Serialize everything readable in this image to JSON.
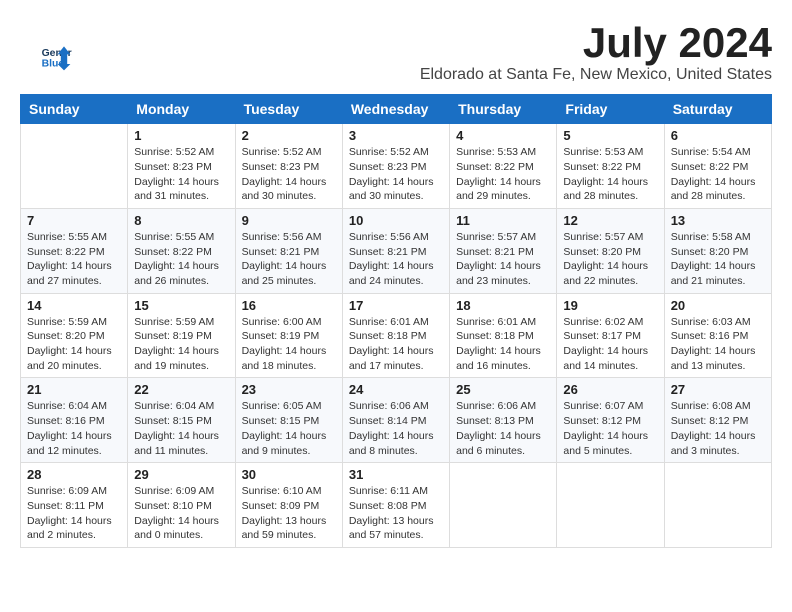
{
  "logo": {
    "line1": "General",
    "line2": "Blue"
  },
  "title": "July 2024",
  "location": "Eldorado at Santa Fe, New Mexico, United States",
  "days_of_week": [
    "Sunday",
    "Monday",
    "Tuesday",
    "Wednesday",
    "Thursday",
    "Friday",
    "Saturday"
  ],
  "weeks": [
    [
      {
        "day": "",
        "info": ""
      },
      {
        "day": "1",
        "info": "Sunrise: 5:52 AM\nSunset: 8:23 PM\nDaylight: 14 hours\nand 31 minutes."
      },
      {
        "day": "2",
        "info": "Sunrise: 5:52 AM\nSunset: 8:23 PM\nDaylight: 14 hours\nand 30 minutes."
      },
      {
        "day": "3",
        "info": "Sunrise: 5:52 AM\nSunset: 8:23 PM\nDaylight: 14 hours\nand 30 minutes."
      },
      {
        "day": "4",
        "info": "Sunrise: 5:53 AM\nSunset: 8:22 PM\nDaylight: 14 hours\nand 29 minutes."
      },
      {
        "day": "5",
        "info": "Sunrise: 5:53 AM\nSunset: 8:22 PM\nDaylight: 14 hours\nand 28 minutes."
      },
      {
        "day": "6",
        "info": "Sunrise: 5:54 AM\nSunset: 8:22 PM\nDaylight: 14 hours\nand 28 minutes."
      }
    ],
    [
      {
        "day": "7",
        "info": "Sunrise: 5:55 AM\nSunset: 8:22 PM\nDaylight: 14 hours\nand 27 minutes."
      },
      {
        "day": "8",
        "info": "Sunrise: 5:55 AM\nSunset: 8:22 PM\nDaylight: 14 hours\nand 26 minutes."
      },
      {
        "day": "9",
        "info": "Sunrise: 5:56 AM\nSunset: 8:21 PM\nDaylight: 14 hours\nand 25 minutes."
      },
      {
        "day": "10",
        "info": "Sunrise: 5:56 AM\nSunset: 8:21 PM\nDaylight: 14 hours\nand 24 minutes."
      },
      {
        "day": "11",
        "info": "Sunrise: 5:57 AM\nSunset: 8:21 PM\nDaylight: 14 hours\nand 23 minutes."
      },
      {
        "day": "12",
        "info": "Sunrise: 5:57 AM\nSunset: 8:20 PM\nDaylight: 14 hours\nand 22 minutes."
      },
      {
        "day": "13",
        "info": "Sunrise: 5:58 AM\nSunset: 8:20 PM\nDaylight: 14 hours\nand 21 minutes."
      }
    ],
    [
      {
        "day": "14",
        "info": "Sunrise: 5:59 AM\nSunset: 8:20 PM\nDaylight: 14 hours\nand 20 minutes."
      },
      {
        "day": "15",
        "info": "Sunrise: 5:59 AM\nSunset: 8:19 PM\nDaylight: 14 hours\nand 19 minutes."
      },
      {
        "day": "16",
        "info": "Sunrise: 6:00 AM\nSunset: 8:19 PM\nDaylight: 14 hours\nand 18 minutes."
      },
      {
        "day": "17",
        "info": "Sunrise: 6:01 AM\nSunset: 8:18 PM\nDaylight: 14 hours\nand 17 minutes."
      },
      {
        "day": "18",
        "info": "Sunrise: 6:01 AM\nSunset: 8:18 PM\nDaylight: 14 hours\nand 16 minutes."
      },
      {
        "day": "19",
        "info": "Sunrise: 6:02 AM\nSunset: 8:17 PM\nDaylight: 14 hours\nand 14 minutes."
      },
      {
        "day": "20",
        "info": "Sunrise: 6:03 AM\nSunset: 8:16 PM\nDaylight: 14 hours\nand 13 minutes."
      }
    ],
    [
      {
        "day": "21",
        "info": "Sunrise: 6:04 AM\nSunset: 8:16 PM\nDaylight: 14 hours\nand 12 minutes."
      },
      {
        "day": "22",
        "info": "Sunrise: 6:04 AM\nSunset: 8:15 PM\nDaylight: 14 hours\nand 11 minutes."
      },
      {
        "day": "23",
        "info": "Sunrise: 6:05 AM\nSunset: 8:15 PM\nDaylight: 14 hours\nand 9 minutes."
      },
      {
        "day": "24",
        "info": "Sunrise: 6:06 AM\nSunset: 8:14 PM\nDaylight: 14 hours\nand 8 minutes."
      },
      {
        "day": "25",
        "info": "Sunrise: 6:06 AM\nSunset: 8:13 PM\nDaylight: 14 hours\nand 6 minutes."
      },
      {
        "day": "26",
        "info": "Sunrise: 6:07 AM\nSunset: 8:12 PM\nDaylight: 14 hours\nand 5 minutes."
      },
      {
        "day": "27",
        "info": "Sunrise: 6:08 AM\nSunset: 8:12 PM\nDaylight: 14 hours\nand 3 minutes."
      }
    ],
    [
      {
        "day": "28",
        "info": "Sunrise: 6:09 AM\nSunset: 8:11 PM\nDaylight: 14 hours\nand 2 minutes."
      },
      {
        "day": "29",
        "info": "Sunrise: 6:09 AM\nSunset: 8:10 PM\nDaylight: 14 hours\nand 0 minutes."
      },
      {
        "day": "30",
        "info": "Sunrise: 6:10 AM\nSunset: 8:09 PM\nDaylight: 13 hours\nand 59 minutes."
      },
      {
        "day": "31",
        "info": "Sunrise: 6:11 AM\nSunset: 8:08 PM\nDaylight: 13 hours\nand 57 minutes."
      },
      {
        "day": "",
        "info": ""
      },
      {
        "day": "",
        "info": ""
      },
      {
        "day": "",
        "info": ""
      }
    ]
  ]
}
